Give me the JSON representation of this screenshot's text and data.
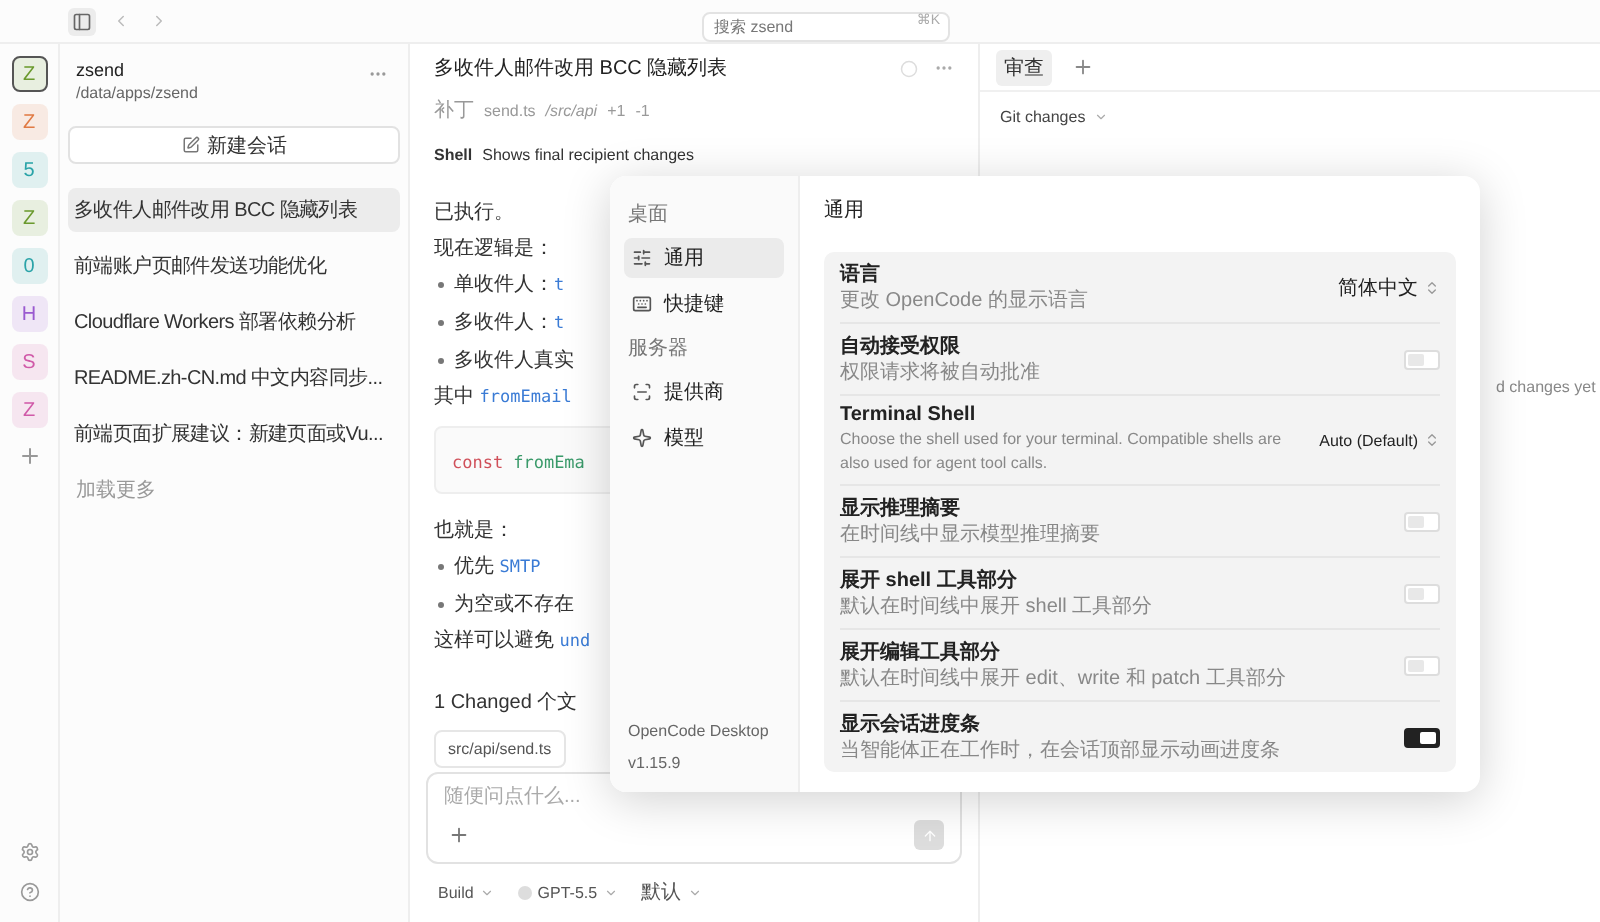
{
  "topbar": {
    "search": {
      "placeholder": "搜索 zsend",
      "shortcut": "⌘K"
    }
  },
  "projects": [
    {
      "letter": "Z",
      "color": "#6b9a2e",
      "selected": true
    },
    {
      "letter": "Z",
      "color": "#e07b45",
      "selected": false
    },
    {
      "letter": "5",
      "color": "#2aa3a8",
      "selected": false
    },
    {
      "letter": "Z",
      "color": "#6b9a2e",
      "selected": false
    },
    {
      "letter": "0",
      "color": "#2aa3a8",
      "selected": false
    },
    {
      "letter": "H",
      "color": "#9a5ad0",
      "selected": false
    },
    {
      "letter": "S",
      "color": "#d05aa8",
      "selected": false
    },
    {
      "letter": "Z",
      "color": "#d05aa8",
      "selected": false
    }
  ],
  "sidebar": {
    "name": "zsend",
    "path": "/data/apps/zsend",
    "new_session": "新建会话",
    "load_more": "加载更多",
    "sessions": [
      {
        "title": "多收件人邮件改用 BCC 隐藏列表",
        "selected": true
      },
      {
        "title": "前端账户页邮件发送功能优化",
        "selected": false
      },
      {
        "title": "Cloudflare Workers 部署依赖分析",
        "selected": false
      },
      {
        "title": "README.zh-CN.md 中文内容同步...",
        "selected": false
      },
      {
        "title": "前端页面扩展建议：新建页面或Vu...",
        "selected": false
      }
    ]
  },
  "chat": {
    "title": "多收件人邮件改用 BCC 隐藏列表",
    "patch": {
      "label": "补丁",
      "file": "send.ts",
      "dir": "/src/api",
      "added": "+1",
      "removed": "-1"
    },
    "shell": {
      "label": "Shell",
      "description": "Shows final recipient changes"
    },
    "messages": [
      {
        "kind": "paragraph",
        "parts": [
          {
            "text": "已执行。"
          }
        ]
      },
      {
        "kind": "paragraph",
        "parts": [
          {
            "text": "现在逻辑是："
          }
        ]
      },
      {
        "kind": "bullet",
        "parts": [
          {
            "text": "单收件人："
          },
          {
            "text": "t",
            "code": true
          }
        ]
      },
      {
        "kind": "bullet",
        "parts": [
          {
            "text": "多收件人："
          },
          {
            "text": "t",
            "code": true
          }
        ]
      },
      {
        "kind": "bullet",
        "parts": [
          {
            "text": "多收件人真实"
          }
        ]
      },
      {
        "kind": "paragraph",
        "parts": [
          {
            "text": "其中 "
          },
          {
            "text": "fromEmail",
            "code": true
          }
        ]
      },
      {
        "kind": "code",
        "parts": [
          {
            "text": "const",
            "code": true,
            "keyword": true
          },
          {
            "text": "fromEma",
            "code": true
          }
        ]
      },
      {
        "kind": "paragraph",
        "parts": [
          {
            "text": "也就是："
          }
        ]
      },
      {
        "kind": "bullet",
        "parts": [
          {
            "text": "优先 "
          },
          {
            "text": "SMTP",
            "code": true
          }
        ]
      },
      {
        "kind": "bullet",
        "parts": [
          {
            "text": "为空或不存在"
          }
        ]
      },
      {
        "kind": "paragraph",
        "parts": [
          {
            "text": "这样可以避免 "
          },
          {
            "text": "und",
            "code": true
          }
        ]
      }
    ],
    "changes": {
      "heading": "1 Changed 个文",
      "files": [
        "src/api/send.ts"
      ]
    },
    "composer": {
      "placeholder": "随便问点什么...",
      "send_disabled": true
    },
    "footer": [
      {
        "label": "Build",
        "dot": false
      },
      {
        "label": "GPT-5.5",
        "dot": true
      },
      {
        "label": "默认",
        "dot": false
      }
    ]
  },
  "review": {
    "tabs": [
      {
        "label": "审查",
        "selected": true
      }
    ],
    "source": "Git changes",
    "empty": "d changes yet"
  },
  "settings": {
    "nav": [
      {
        "section": "桌面",
        "items": [
          {
            "label": "通用",
            "selected": true
          },
          {
            "label": "快捷键",
            "selected": false
          }
        ]
      },
      {
        "section": "服务器",
        "items": [
          {
            "label": "提供商",
            "selected": false
          },
          {
            "label": "模型",
            "selected": false
          }
        ]
      }
    ],
    "app_name": "OpenCode Desktop",
    "version": "v1.15.9",
    "title": "通用",
    "rows": [
      {
        "kind": "select",
        "title": "语言",
        "description": "更改 OpenCode 的显示语言",
        "value": "简体中文"
      },
      {
        "kind": "toggle",
        "title": "自动接受权限",
        "description": "权限请求将被自动批准",
        "on": false
      },
      {
        "kind": "select",
        "title": "Terminal Shell",
        "description": "Choose the shell used for your terminal. Compatible shells are also used for agent tool calls.",
        "value": "Auto (Default)"
      },
      {
        "kind": "toggle",
        "title": "显示推理摘要",
        "description": "在时间线中显示模型推理摘要",
        "on": false
      },
      {
        "kind": "toggle",
        "title": "展开 shell 工具部分",
        "description": "默认在时间线中展开 shell 工具部分",
        "on": false
      },
      {
        "kind": "toggle",
        "title": "展开编辑工具部分",
        "description": "默认在时间线中展开 edit、write 和 patch 工具部分",
        "on": false
      },
      {
        "kind": "toggle",
        "title": "显示会话进度条",
        "description": "当智能体正在工作时，在会话顶部显示动画进度条",
        "on": true
      }
    ]
  }
}
